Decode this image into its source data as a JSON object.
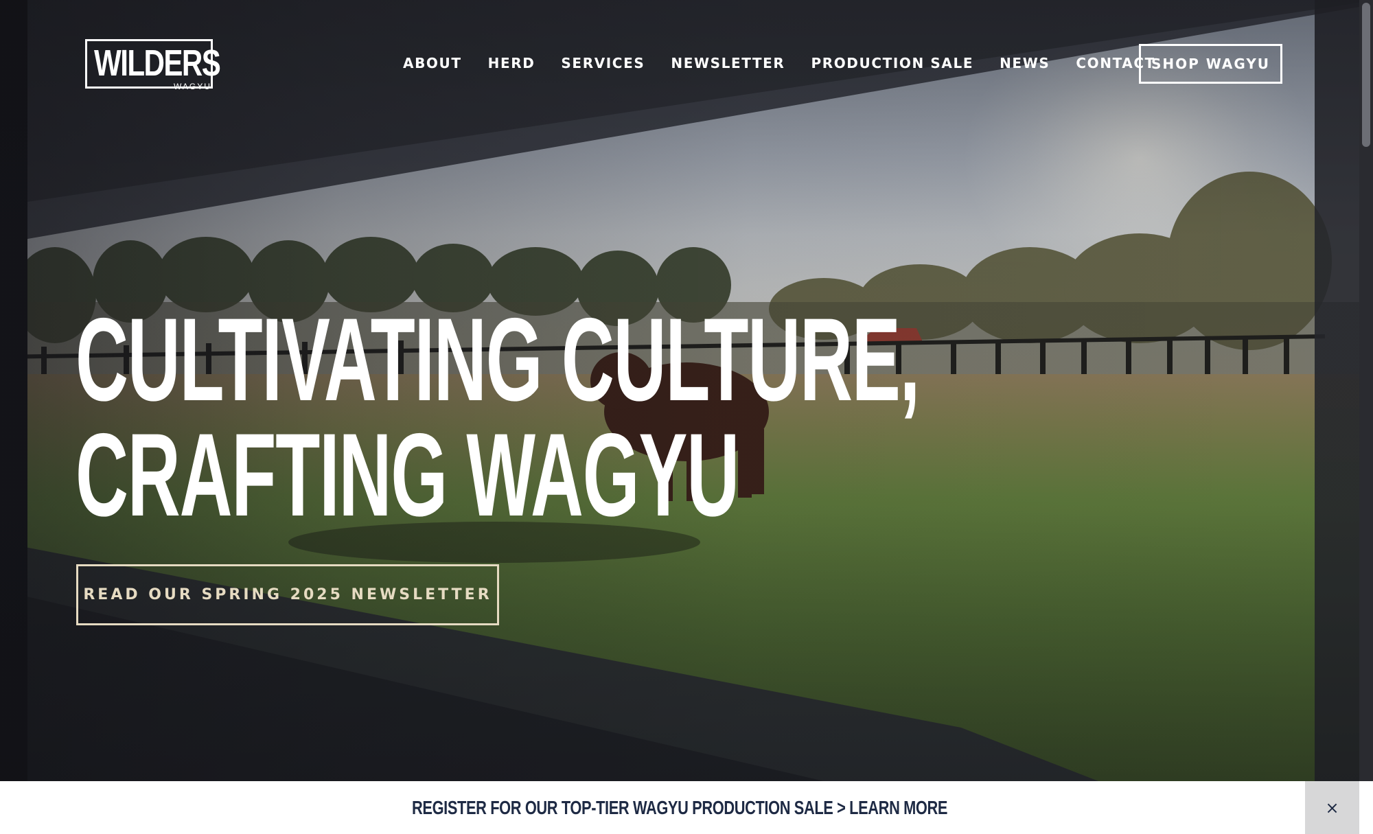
{
  "brand": {
    "logo_main": "WILDERS",
    "logo_sub": "WAGYU"
  },
  "nav": {
    "items": [
      {
        "label": "ABOUT"
      },
      {
        "label": "HERD"
      },
      {
        "label": "SERVICES"
      },
      {
        "label": "NEWSLETTER"
      },
      {
        "label": "PRODUCTION SALE"
      },
      {
        "label": "NEWS"
      },
      {
        "label": "CONTACT"
      }
    ],
    "shop_label": "SHOP WAGYU"
  },
  "hero": {
    "headline_line1": "CULTIVATING CULTURE,",
    "headline_line2": "CRAFTING WAGYU",
    "cta_label": "READ OUR SPRING 2025 NEWSLETTER"
  },
  "announcement": {
    "text": "REGISTER FOR OUR TOP-TIER WAGYU PRODUCTION SALE > LEARN MORE",
    "close_glyph": "×"
  },
  "colors": {
    "accent_cta": "#e6dbc2",
    "announcement_text": "#1e2a44",
    "close_bg": "#d7d7d8"
  }
}
